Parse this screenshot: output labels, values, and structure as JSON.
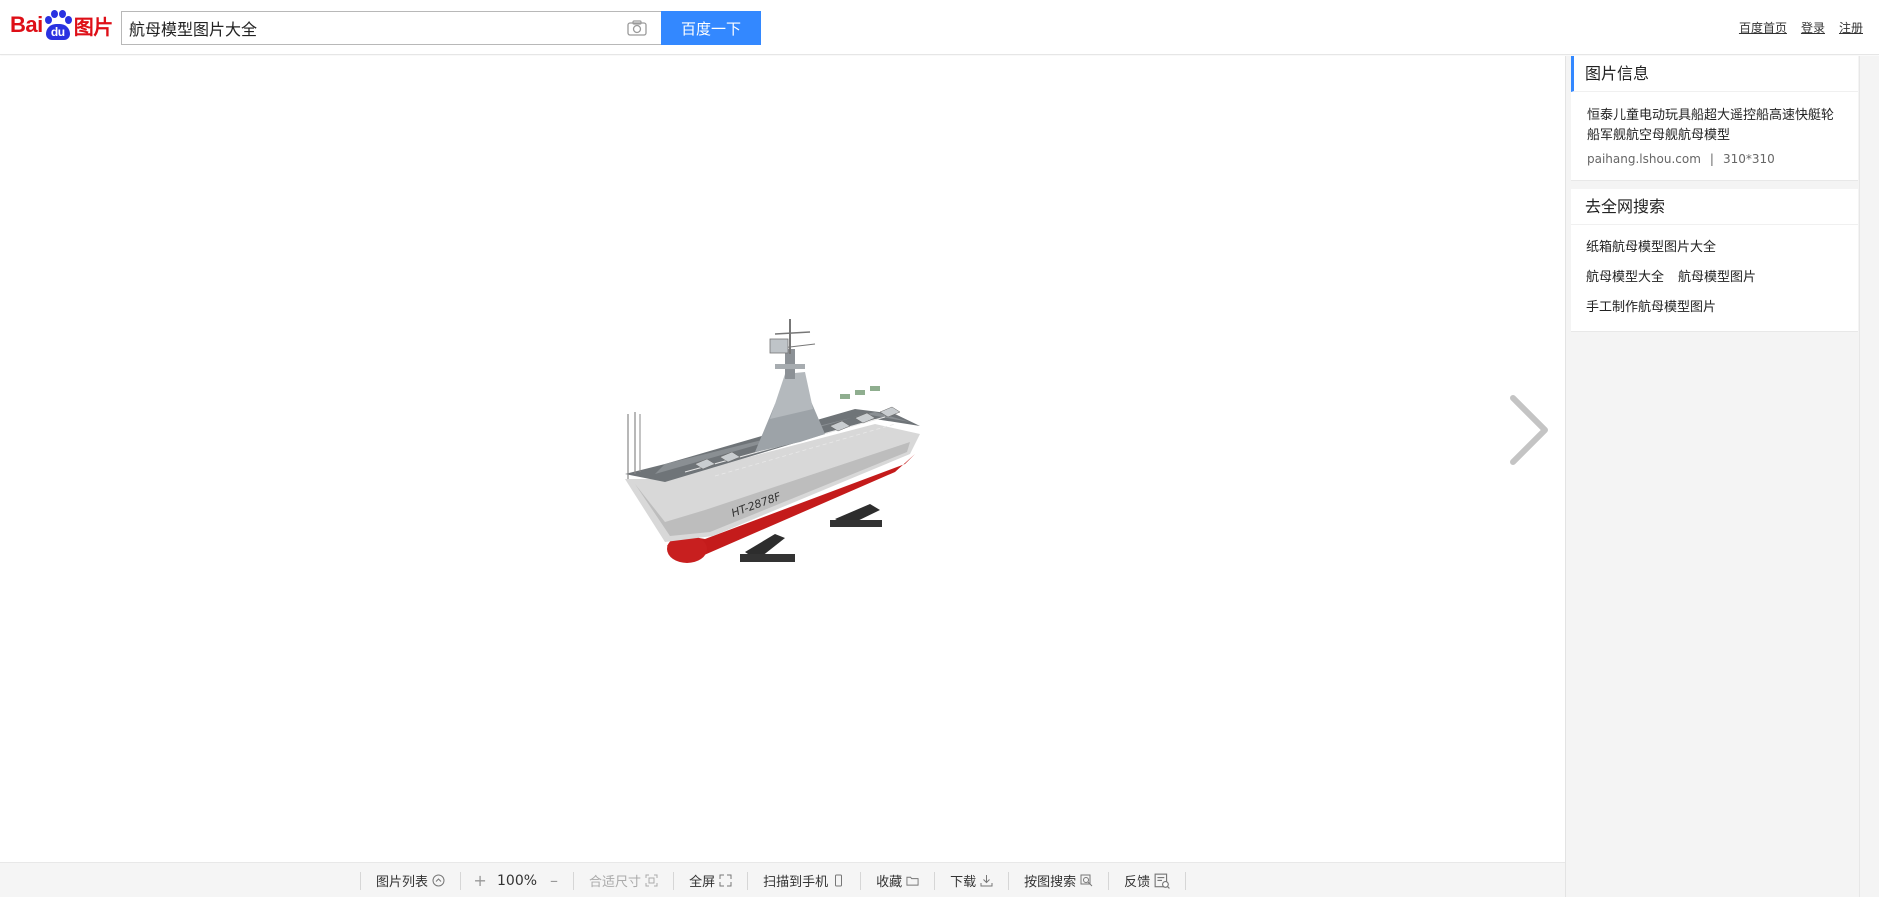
{
  "header": {
    "logo": {
      "bai": "Bai",
      "du": "du",
      "tupian": "图片"
    },
    "search": {
      "value": "航母模型图片大全"
    },
    "search_button_label": "百度一下",
    "links": [
      {
        "label": "百度首页"
      },
      {
        "label": "登录"
      },
      {
        "label": "注册"
      }
    ]
  },
  "toolbar": {
    "image_list_label": "图片列表",
    "zoom_in": "+",
    "zoom_value": "100%",
    "zoom_out": "–",
    "fit_size_label": "合适尺寸",
    "fullscreen_label": "全屏",
    "scan_to_phone_label": "扫描到手机",
    "collect_label": "收藏",
    "download_label": "下载",
    "search_by_image_label": "按图搜索",
    "feedback_label": "反馈"
  },
  "sidebar": {
    "info": {
      "title": "图片信息",
      "description": "恒泰儿童电动玩具船超大遥控船高速快艇轮船军舰航空母舰航母模型",
      "source": "paihang.lshou.com",
      "separator": "|",
      "dimensions": "310*310"
    },
    "web_search": {
      "title": "去全网搜索",
      "rows": [
        [
          "纸箱航母模型图片大全"
        ],
        [
          "航母模型大全",
          "航母模型图片"
        ],
        [
          "手工制作航母模型图片"
        ]
      ]
    }
  },
  "colors": {
    "accent": "#3388ff",
    "brand_red": "#de0f17",
    "brand_blue": "#2932e1"
  },
  "icons": {
    "camera": "camera-icon",
    "next": "chevron-right-icon",
    "main_image": "aircraft-carrier-model"
  }
}
